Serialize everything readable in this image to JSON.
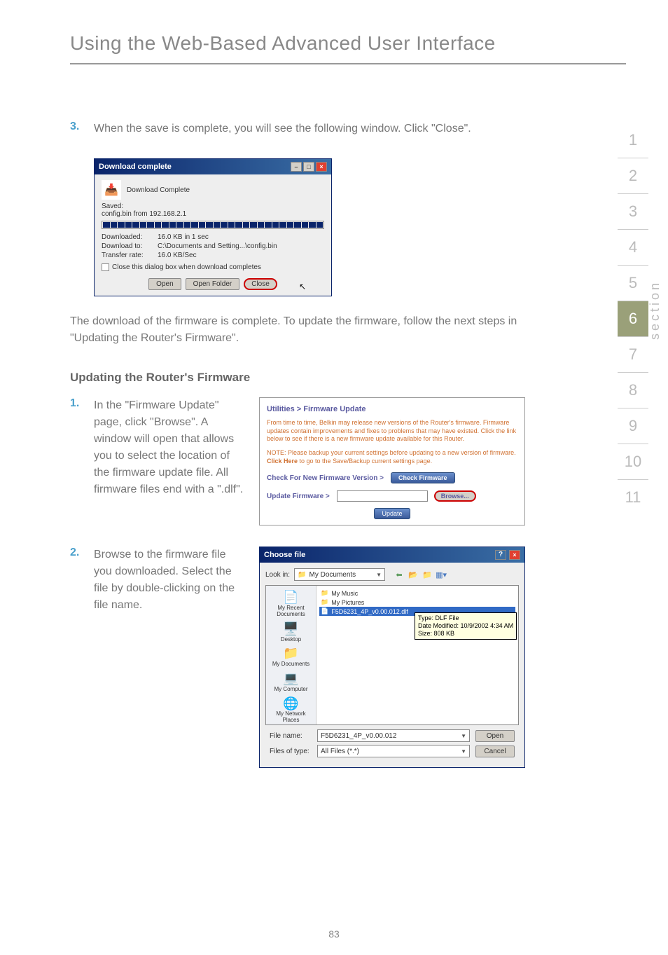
{
  "page_title": "Using the Web-Based Advanced User Interface",
  "page_number": "83",
  "section_label": "section",
  "section_nav": {
    "items": [
      "1",
      "2",
      "3",
      "4",
      "5",
      "6",
      "7",
      "8",
      "9",
      "10",
      "11"
    ],
    "active_index": 5
  },
  "step3": {
    "num": "3.",
    "text": "When the save is complete, you will see the following window. Click \"Close\"."
  },
  "download_dialog": {
    "title": "Download complete",
    "heading": "Download Complete",
    "saved_label": "Saved:",
    "saved_value": "config.bin from 192.168.2.1",
    "rows": {
      "downloaded_label": "Downloaded:",
      "downloaded_value": "16.0 KB in 1 sec",
      "download_to_label": "Download to:",
      "download_to_value": "C:\\Documents and Setting...\\config.bin",
      "transfer_rate_label": "Transfer rate:",
      "transfer_rate_value": "16.0 KB/Sec"
    },
    "checkbox_label": "Close this dialog box when download completes",
    "buttons": {
      "open": "Open",
      "open_folder": "Open Folder",
      "close": "Close"
    }
  },
  "mid_paragraph": "The download of the firmware is complete. To update the firmware, follow the next steps in \"Updating the Router's Firmware\".",
  "subheading": "Updating the Router's Firmware",
  "step1": {
    "num": "1.",
    "text": "In the \"Firmware Update\" page, click \"Browse\". A window will open that allows you to select the location of the firmware update file. All firmware files end with a \".dlf\"."
  },
  "fw_panel": {
    "breadcrumb": "Utilities > Firmware Update",
    "text1": "From time to time, Belkin may release new versions of the Router's firmware. Firmware updates contain improvements and fixes to problems that may have existed. Click the link below to see if there is a new firmware update available for this Router.",
    "text2_prefix": "NOTE: Please backup your current settings before updating to a new version of firmware. ",
    "text2_link": "Click Here",
    "text2_suffix": " to go to the Save/Backup current settings page.",
    "check_label": "Check For New Firmware Version >",
    "check_btn": "Check Firmware",
    "update_label": "Update Firmware >",
    "browse_btn": "Browse...",
    "update_btn": "Update"
  },
  "step2": {
    "num": "2.",
    "text": "Browse to the firmware file you downloaded. Select the file by double-clicking on the file name."
  },
  "choose_file": {
    "title": "Choose file",
    "lookin_label": "Look in:",
    "lookin_value": "My Documents",
    "sidebar": [
      "My Recent Documents",
      "Desktop",
      "My Documents",
      "My Computer",
      "My Network Places"
    ],
    "files": {
      "folder1": "My Music",
      "folder2": "My Pictures",
      "selected": "F5D6231_4P_v0.00.012.dlf"
    },
    "tooltip": {
      "line1": "Type: DLF File",
      "line2": "Date Modified: 10/9/2002 4:34 AM",
      "line3": "Size: 808 KB"
    },
    "filename_label": "File name:",
    "filename_value": "F5D6231_4P_v0.00.012",
    "filetype_label": "Files of type:",
    "filetype_value": "All Files (*.*)",
    "open_btn": "Open",
    "cancel_btn": "Cancel"
  }
}
